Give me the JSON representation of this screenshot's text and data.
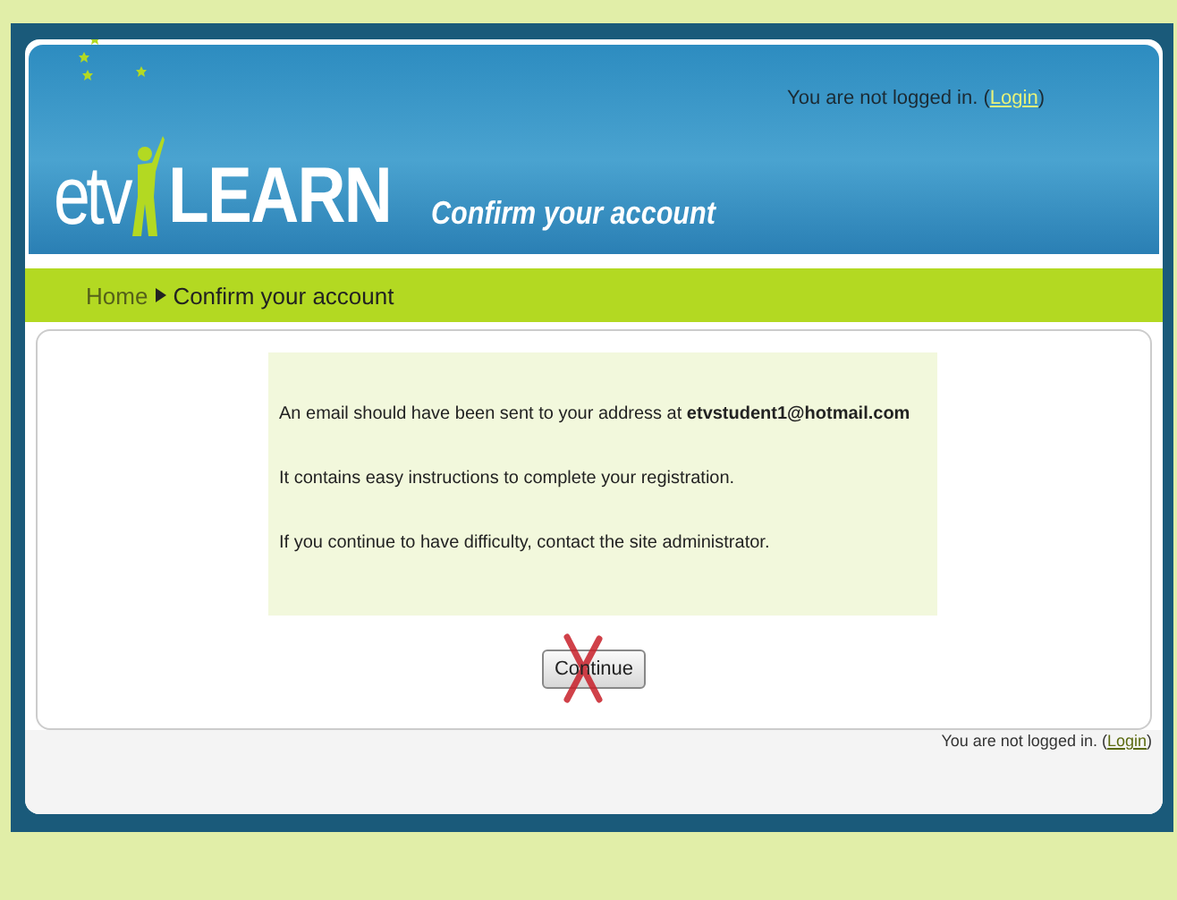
{
  "header": {
    "logo": {
      "prefix": "etv",
      "suffix": "LEARN"
    },
    "page_title": "Confirm your account",
    "login_info": {
      "text": "You are not logged in. (",
      "link": "Login",
      "after": ")"
    }
  },
  "breadcrumb": [
    {
      "label": "Home",
      "kind": "link"
    },
    {
      "label": "Confirm your account",
      "kind": "current"
    }
  ],
  "message": [
    "An email should have been sent to your address at **etvstudent1@hotmail.com**",
    "It contains easy instructions to complete your registration.",
    "If you continue to have difficulty, contact the site administrator."
  ],
  "continue_button": {
    "label": "Continue",
    "crossed_out": true
  },
  "footer": {
    "login_info": {
      "text": "You are not logged in. (",
      "link": "Login",
      "after": ")"
    }
  }
}
